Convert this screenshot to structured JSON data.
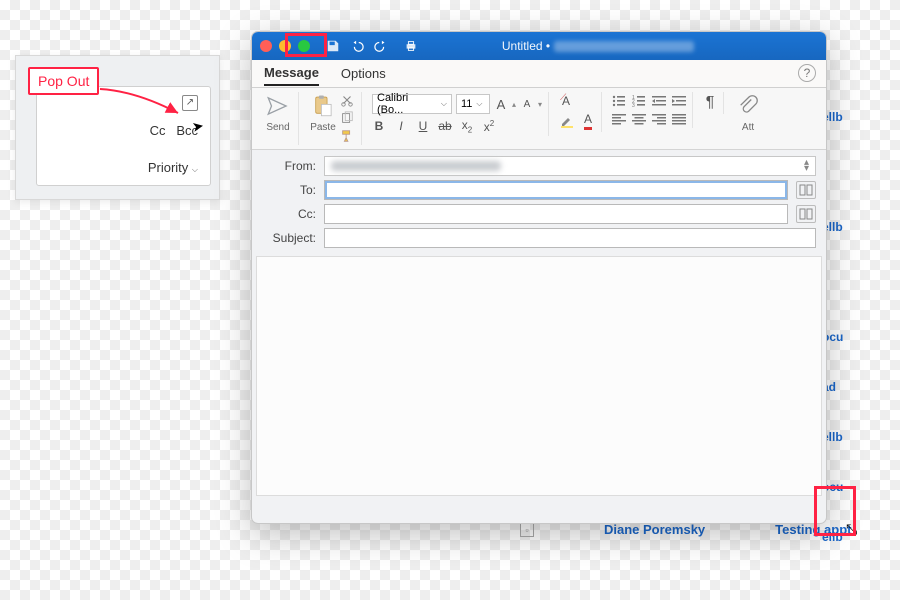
{
  "annotation": {
    "popout": "Pop Out"
  },
  "popcard": {
    "cc": "Cc",
    "bcc": "Bcc",
    "priority": "Priority"
  },
  "titlebar": {
    "title": "Untitled •"
  },
  "tabs": {
    "message": "Message",
    "options": "Options"
  },
  "ribbon": {
    "send": "Send",
    "paste": "Paste",
    "font_name": "Calibri (Bo...",
    "font_size": "11",
    "increase": "A",
    "decrease": "A",
    "clearfmt": "A",
    "bold": "B",
    "italic": "I",
    "underline": "U",
    "strike": "ab",
    "sub": "x",
    "sub2": "2",
    "sup": "x",
    "sup2": "2",
    "pilcrow": "¶",
    "attach": "Att"
  },
  "fields": {
    "from": "From:",
    "to": "To:",
    "cc": "Cc:",
    "subject": "Subject:"
  },
  "behind_links": [
    "ellb",
    "ellb",
    "ocu",
    "ad",
    "ellb",
    "ocu",
    "ellb"
  ],
  "listrow": {
    "sender": "Diane Poremsky",
    "subject": "Testing appt"
  }
}
